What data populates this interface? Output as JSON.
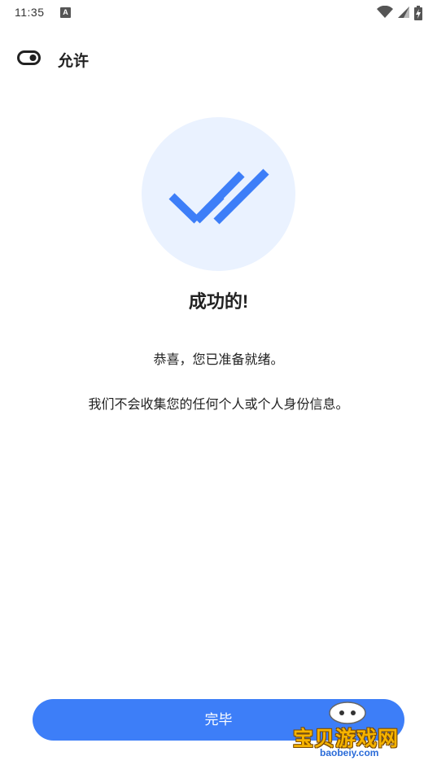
{
  "status_bar": {
    "time": "11:35",
    "notification_icon": "a-badge-icon",
    "right_icons": [
      "wifi-icon",
      "signal-icon",
      "battery-charging-icon"
    ]
  },
  "header": {
    "icon": "toggle-switch-icon",
    "title": "允许"
  },
  "hero": {
    "icon": "double-check-icon",
    "circle_color": "#eaf2ff",
    "icon_color": "#3d7ef8"
  },
  "content": {
    "title": "成功的!",
    "message_1": "恭喜，您已准备就绪。",
    "message_2": "我们不会收集您的任何个人或个人身份信息。"
  },
  "footer": {
    "done_label": "完毕",
    "button_color": "#3d7ef8"
  },
  "watermark": {
    "text": "宝贝游戏网",
    "url": "baobeiy.com"
  }
}
